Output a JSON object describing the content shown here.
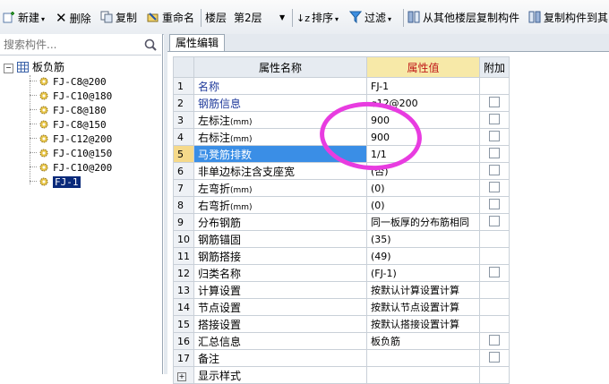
{
  "toolbar": {
    "new": "新建",
    "delete": "删除",
    "copy": "复制",
    "rename": "重命名",
    "floor_label": "楼层",
    "floor_value": "第2层",
    "sort": "排序",
    "filter": "过滤",
    "copy_from_floor": "从其他楼层复制构件",
    "copy_to_floor": "复制构件到其"
  },
  "left": {
    "search_placeholder": "搜索构件...",
    "root_label": "板负筋",
    "items": [
      "FJ-C8@200",
      "FJ-C10@180",
      "FJ-C8@180",
      "FJ-C8@150",
      "FJ-C12@200",
      "FJ-C10@150",
      "FJ-C10@200",
      "FJ-1"
    ]
  },
  "panel": {
    "tab": "属性编辑",
    "headers": {
      "name": "属性名称",
      "value": "属性值",
      "extra": "附加"
    },
    "rows": [
      {
        "n": "1",
        "name": "名称",
        "value": "FJ-1"
      },
      {
        "n": "2",
        "name": "钢筋信息",
        "value": "⌀12@200"
      },
      {
        "n": "3",
        "name": "左标注",
        "unit": "(mm)",
        "value": "900"
      },
      {
        "n": "4",
        "name": "右标注",
        "unit": "(mm)",
        "value": "900"
      },
      {
        "n": "5",
        "name": "马凳筋排数",
        "value": "1/1"
      },
      {
        "n": "6",
        "name": "非单边标注含支座宽",
        "value": "(否)"
      },
      {
        "n": "7",
        "name": "左弯折",
        "unit": "(mm)",
        "value": "(0)"
      },
      {
        "n": "8",
        "name": "右弯折",
        "unit": "(mm)",
        "value": "(0)"
      },
      {
        "n": "9",
        "name": "分布钢筋",
        "value": "同一板厚的分布筋相同"
      },
      {
        "n": "10",
        "name": "钢筋锚固",
        "value": "(35)"
      },
      {
        "n": "11",
        "name": "钢筋搭接",
        "value": "(49)"
      },
      {
        "n": "12",
        "name": "归类名称",
        "value": "(FJ-1)"
      },
      {
        "n": "13",
        "name": "计算设置",
        "value": "按默认计算设置计算"
      },
      {
        "n": "14",
        "name": "节点设置",
        "value": "按默认节点设置计算"
      },
      {
        "n": "15",
        "name": "搭接设置",
        "value": "按默认搭接设置计算"
      },
      {
        "n": "16",
        "name": "汇总信息",
        "value": "板负筋"
      },
      {
        "n": "17",
        "name": "备注",
        "value": ""
      },
      {
        "n": "18",
        "name": "显示样式",
        "value": ""
      }
    ]
  },
  "colors": {
    "annotation": "#e83ce0",
    "selected_row": "#3a8ee6",
    "header_value_bg": "#f7e9a8"
  }
}
